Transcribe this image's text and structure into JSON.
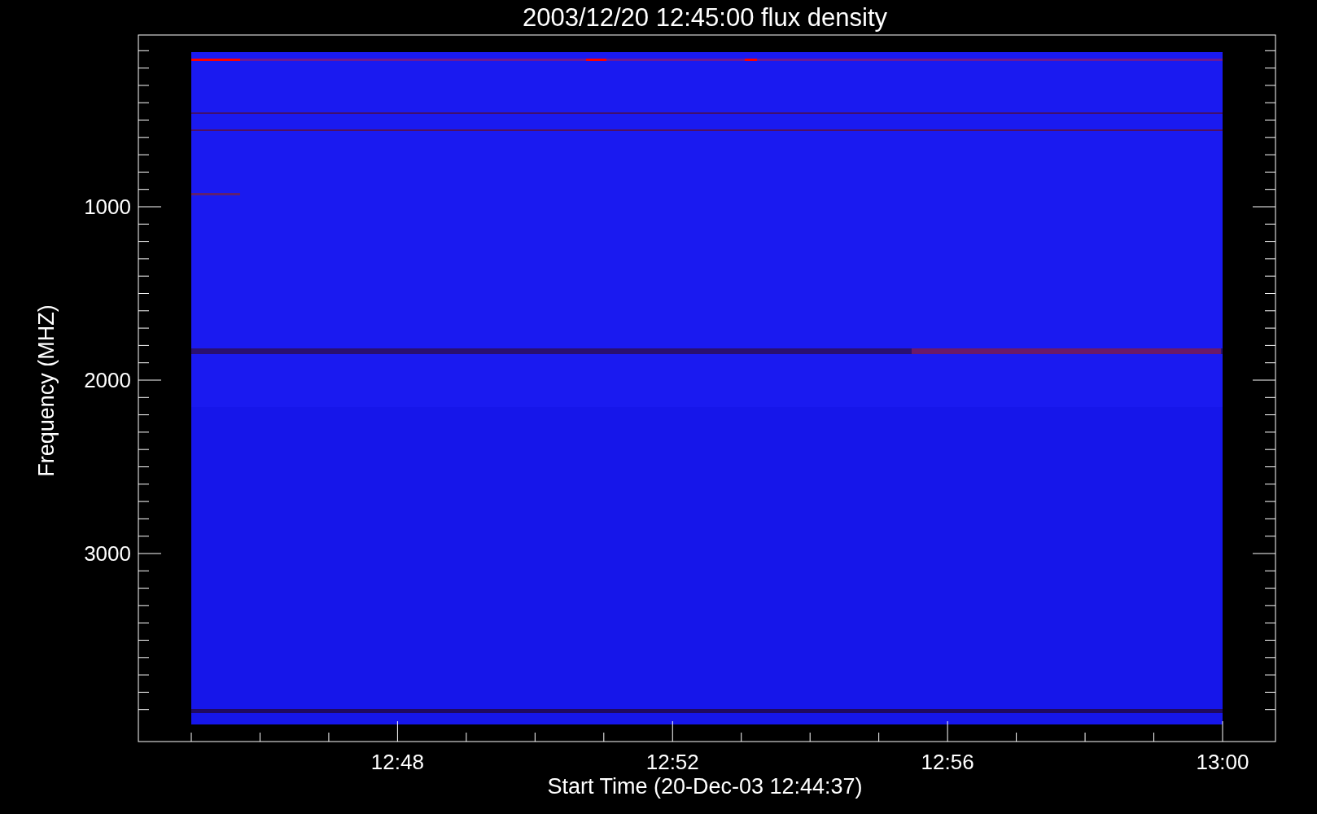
{
  "title": "2003/12/20 12:45:00 flux density",
  "y_axis": {
    "label": "Frequency (MHZ)",
    "ticks": [
      "1000",
      "2000",
      "3000"
    ]
  },
  "x_axis": {
    "label": "Start Time (20-Dec-03 12:44:37)",
    "ticks": [
      "12:48",
      "12:52",
      "12:56",
      "13:00"
    ]
  }
}
